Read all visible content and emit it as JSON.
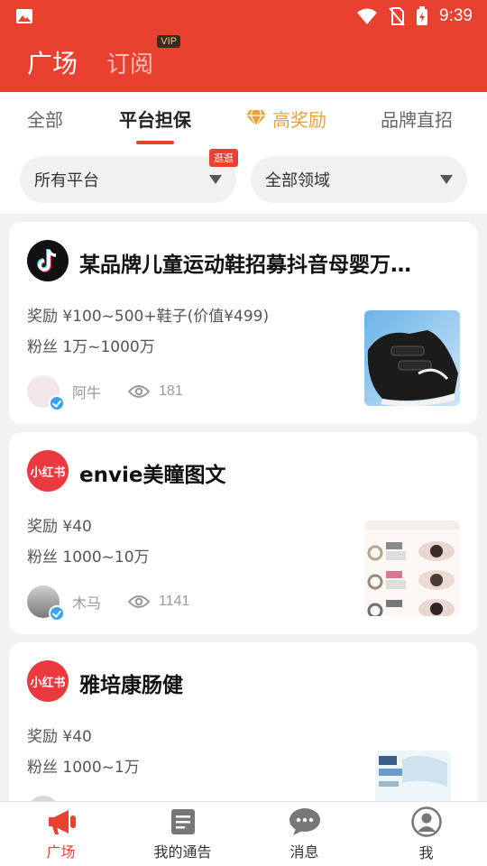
{
  "status": {
    "time": "9:39"
  },
  "header": {
    "tab_active": "广场",
    "tab_other": "订阅",
    "vip_badge": "VIP"
  },
  "subtabs": [
    {
      "label": "全部"
    },
    {
      "label": "平台担保"
    },
    {
      "label": "高奖励"
    },
    {
      "label": "品牌直招"
    }
  ],
  "filters": {
    "platform": "所有平台",
    "platform_badge": "逛逛",
    "domain": "全部领域"
  },
  "cards": [
    {
      "platform_icon": "douyin-logo",
      "title": "某品牌儿童运动鞋招募抖音母婴万…",
      "reward": "奖励 ¥100~500+鞋子(价值¥499)",
      "fans": "粉丝 1万~1000万",
      "author": "阿牛",
      "views": "181"
    },
    {
      "platform_icon": "xiaohongshu-logo",
      "platform_text": "小红书",
      "title": "envie美瞳图文",
      "reward": "奖励 ¥40",
      "fans": "粉丝 1000~10万",
      "author": "木马",
      "views": "1141"
    },
    {
      "platform_icon": "xiaohongshu-logo",
      "platform_text": "小红书",
      "title": "雅培康肠健",
      "reward": "奖励 ¥40",
      "fans": "粉丝 1000~1万"
    }
  ],
  "bottom_nav": [
    {
      "label": "广场",
      "icon": "megaphone-icon"
    },
    {
      "label": "我的通告",
      "icon": "document-icon"
    },
    {
      "label": "消息",
      "icon": "chat-icon"
    },
    {
      "label": "我",
      "icon": "user-icon"
    }
  ],
  "colors": {
    "brand": "#e8412f",
    "gold": "#e9a23b"
  }
}
